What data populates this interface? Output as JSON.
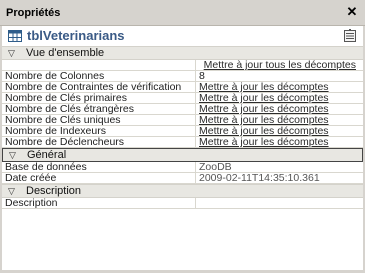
{
  "panel": {
    "title": "Propriétés",
    "close_glyph": "✕"
  },
  "object": {
    "name": "tblVeterinarians",
    "icon": "table-icon",
    "toolbar_icon": "property-pages-icon"
  },
  "sections": {
    "overview": {
      "label": "Vue d'ensemble",
      "update_all": "Mettre à jour tous les décomptes",
      "rows": [
        {
          "key": "Nombre de Colonnes",
          "value": "8"
        },
        {
          "key": "Nombre de Contraintes de vérification",
          "value": "Mettre à jour les décomptes"
        },
        {
          "key": "Nombre de Clés primaires",
          "value": "Mettre à jour les décomptes"
        },
        {
          "key": "Nombre de Clés étrangères",
          "value": "Mettre à jour les décomptes"
        },
        {
          "key": "Nombre de Clés uniques",
          "value": "Mettre à jour les décomptes"
        },
        {
          "key": "Nombre de Indexeurs",
          "value": "Mettre à jour les décomptes"
        },
        {
          "key": "Nombre de Déclencheurs",
          "value": "Mettre à jour les décomptes"
        }
      ]
    },
    "general": {
      "label": "Général",
      "rows": [
        {
          "key": "Base de données",
          "value": "ZooDB"
        },
        {
          "key": "Date créée",
          "value": "2009-02-11T14:35:10.361"
        }
      ]
    },
    "description": {
      "label": "Description",
      "rows": [
        {
          "key": "Description",
          "value": ""
        }
      ]
    }
  }
}
